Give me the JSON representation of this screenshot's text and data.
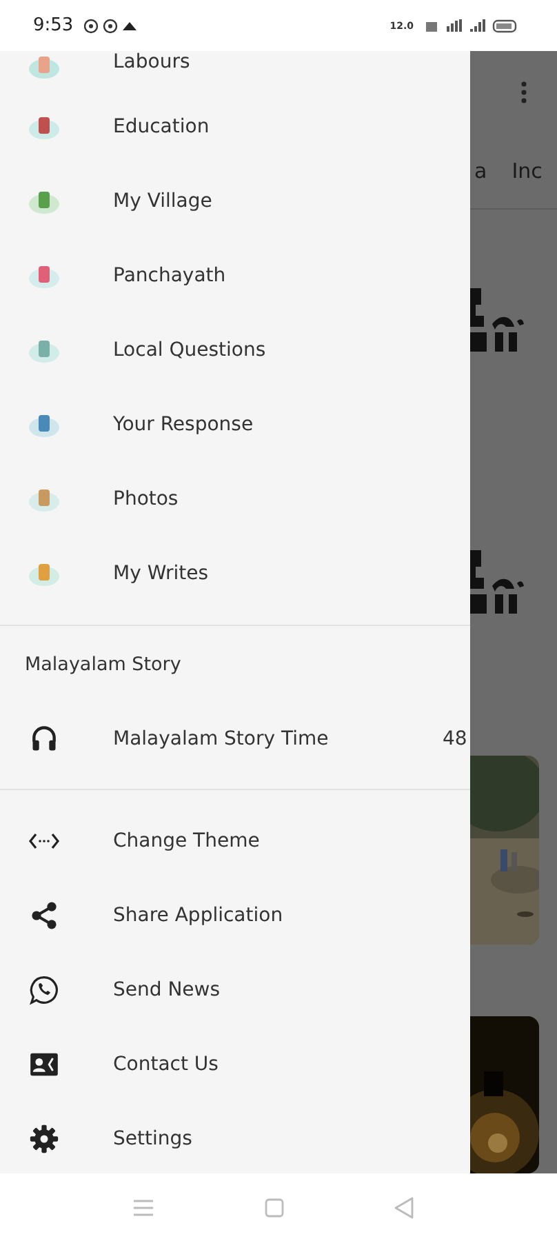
{
  "status_bar": {
    "time": "9:53",
    "speed": "12.0"
  },
  "background": {
    "tabs": [
      {
        "label": "a"
      },
      {
        "label": "Inc"
      }
    ]
  },
  "drawer": {
    "items": [
      {
        "label": "Labours"
      },
      {
        "label": "Education"
      },
      {
        "label": "My Village"
      },
      {
        "label": "Panchayath"
      },
      {
        "label": "Local Questions"
      },
      {
        "label": "Your Response"
      },
      {
        "label": "Photos"
      },
      {
        "label": "My Writes"
      }
    ],
    "section": {
      "title": "Malayalam Story",
      "items": [
        {
          "label": "Malayalam Story Time",
          "count": "48"
        }
      ]
    },
    "actions": [
      {
        "label": "Change Theme",
        "kind": "theme"
      },
      {
        "label": "Share Application",
        "kind": "share"
      },
      {
        "label": "Send News",
        "kind": "chat"
      },
      {
        "label": "Contact Us",
        "kind": "contact"
      },
      {
        "label": "Settings",
        "kind": "settings"
      }
    ]
  }
}
